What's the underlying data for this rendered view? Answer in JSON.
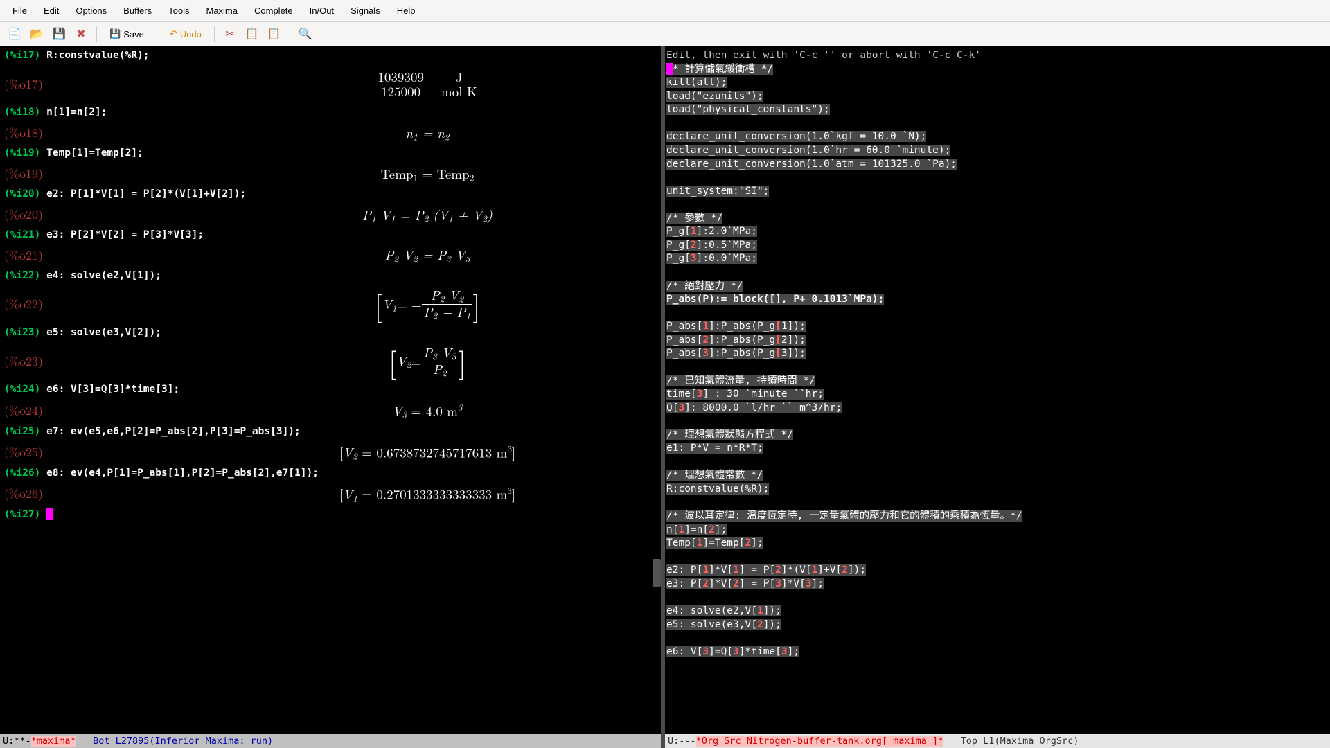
{
  "menu": [
    "File",
    "Edit",
    "Options",
    "Buffers",
    "Tools",
    "Maxima",
    "Complete",
    "In/Out",
    "Signals",
    "Help"
  ],
  "toolbar": {
    "save": "Save",
    "undo": "Undo"
  },
  "left": {
    "i17": "(%i17)",
    "i17c": " R:constvalue(%R);",
    "o17": "(%o17)",
    "o17_num": "1039309",
    "o17_den": "125000",
    "o17_unit_num": "J",
    "o17_unit_den": "mol K",
    "i18": "(%i18)",
    "i18c": " n[1]=n[2];",
    "o18": "(%o18)",
    "o18_m": "n",
    "o18_eq": " = ",
    "o18_s1": "1",
    "o18_s2": "2",
    "i19": "(%i19)",
    "i19c": " Temp[1]=Temp[2];",
    "o19": "(%o19)",
    "o19_a": "Temp",
    "o19_s1": "1",
    "o19_eq": " = ",
    "o19_b": "Temp",
    "o19_s2": "2",
    "i20": "(%i20)",
    "i20c": " e2: P[1]*V[1] = P[2]*(V[1]+V[2]);",
    "o20": "(%o20)",
    "o20_pv": "P",
    "o20_s1": "1",
    "o20_sp": " ",
    "o20_v": "V",
    "o20_eq": " = ",
    "o20_s2": "2",
    "o20_lp": " (",
    "o20_plus": " + ",
    "o20_rp": ")",
    "i21": "(%i21)",
    "i21c": " e3: P[2]*V[2] = P[3]*V[3];",
    "o21": "(%o21)",
    "o21_s3": "3",
    "i22": "(%i22)",
    "i22c": " e4: solve(e2,V[1]);",
    "o22": "(%o22)",
    "o22_neg": " = − ",
    "i23": "(%i23)",
    "i23c": " e5: solve(e3,V[2]);",
    "o23": "(%o23)",
    "i24": "(%i24)",
    "i24c": " e6: V[3]=Q[3]*time[3];",
    "o24": "(%o24)",
    "o24_m": "V",
    "o24_s3": "3",
    "o24_eq": " = 4.0 m",
    "o24_exp": "3",
    "i25": "(%i25)",
    "i25c": " e7: ev(e5,e6,P[2]=P_abs[2],P[3]=P_abs[3]);",
    "o25": "(%o25)",
    "o25_lb": "[",
    "o25_v": "V",
    "o25_s2": "2",
    "o25_eq": " = 0.6738732745717613 m",
    "o25_exp": "3",
    "o25_rb": "]",
    "i26": "(%i26)",
    "i26c": " e8: ev(e4,P[1]=P_abs[1],P[2]=P_abs[2],e7[1]);",
    "o26": "(%o26)",
    "o26_lb": "[",
    "o26_v": "V",
    "o26_s1": "1",
    "o26_eq": " = 0.2701333333333333 m",
    "o26_exp": "3",
    "o26_rb": "]",
    "i27": "(%i27)"
  },
  "left_ml": {
    "pre": "U:**- ",
    "buf": " *maxima*        ",
    "pos": "Bot L27895  ",
    "mode": "(Inferior Maxima: run)"
  },
  "right": {
    "editmsg": "Edit, then exit with 'C-c '' or abort with 'C-c C-k'",
    "lines": [
      {
        "t": "/* 計算儲氣緩衝槽 */",
        "cur": true
      },
      {
        "t": "kill(all);"
      },
      {
        "t": "load(\"ezunits\");"
      },
      {
        "t": "load(\"physical_constants\");"
      },
      {
        "t": ""
      },
      {
        "t": "declare_unit_conversion(1.0`kgf = 10.0 `N);"
      },
      {
        "t": "declare_unit_conversion(1.0`hr = 60.0 `minute);"
      },
      {
        "t": "declare_unit_conversion(1.0`atm = 101325.0 `Pa);"
      },
      {
        "t": ""
      },
      {
        "t": "unit_system:\"SI\";"
      },
      {
        "t": ""
      },
      {
        "t": "/* 參數 */"
      },
      {
        "t": "P_g[1]:2.0`MPa;",
        "n": [
          4
        ]
      },
      {
        "t": "P_g[2]:0.5`MPa;",
        "n": [
          4
        ]
      },
      {
        "t": "P_g[3]:0.0`MPa;",
        "n": [
          4
        ]
      },
      {
        "t": ""
      },
      {
        "t": "/* 絕對壓力 */"
      },
      {
        "t": "P_abs(P):= block([], P+ 0.1013`MPa);",
        "b": true
      },
      {
        "t": ""
      },
      {
        "t": "P_abs[1]:P_abs(P_g[1]);",
        "n": [
          6,
          18
        ]
      },
      {
        "t": "P_abs[2]:P_abs(P_g[2]);",
        "n": [
          6,
          18
        ]
      },
      {
        "t": "P_abs[3]:P_abs(P_g[3]);",
        "n": [
          6,
          18
        ]
      },
      {
        "t": ""
      },
      {
        "t": "/* 已知氣體流量, 持續時間 */"
      },
      {
        "t": "time[3] : 30 `minute ``hr;",
        "n": [
          5
        ]
      },
      {
        "t": "Q[3]: 8000.0 `l/hr `` m^3/hr;",
        "n": [
          2
        ]
      },
      {
        "t": ""
      },
      {
        "t": "/* 理想氣體狀態方程式 */"
      },
      {
        "t": "e1: P*V = n*R*T;"
      },
      {
        "t": ""
      },
      {
        "t": "/* 理想氣體常數 */"
      },
      {
        "t": "R:constvalue(%R);"
      },
      {
        "t": ""
      },
      {
        "t": "/* 波以耳定律: 溫度恆定時, 一定量氣體的壓力和它的體積的乘積為恆量。*/"
      },
      {
        "t": "n[1]=n[2];",
        "n": [
          2,
          7
        ]
      },
      {
        "t": "Temp[1]=Temp[2];",
        "n": [
          5,
          13
        ]
      },
      {
        "t": ""
      },
      {
        "t": "e2: P[1]*V[1] = P[2]*(V[1]+V[2]);",
        "n": [
          6,
          11,
          18,
          24,
          29
        ]
      },
      {
        "t": "e3: P[2]*V[2] = P[3]*V[3];",
        "n": [
          6,
          11,
          18,
          23
        ]
      },
      {
        "t": ""
      },
      {
        "t": "e4: solve(e2,V[1]);",
        "n": [
          15
        ]
      },
      {
        "t": "e5: solve(e3,V[2]);",
        "n": [
          15
        ]
      },
      {
        "t": ""
      },
      {
        "t": "e6: V[3]=Q[3]*time[3];",
        "n": [
          6,
          11,
          19
        ]
      }
    ],
    "partial": "e7:  ev(e5,e6,P[2]=P_abs[2],P[3]=P_abs[3]);"
  },
  "right_ml": {
    "pre": "U:--- ",
    "buf": " *Org Src Nitrogen-buffer-tank.org[ maxima ]* ",
    "pos": "Top L1    ",
    "mode": "(Maxima OrgSrc)"
  }
}
